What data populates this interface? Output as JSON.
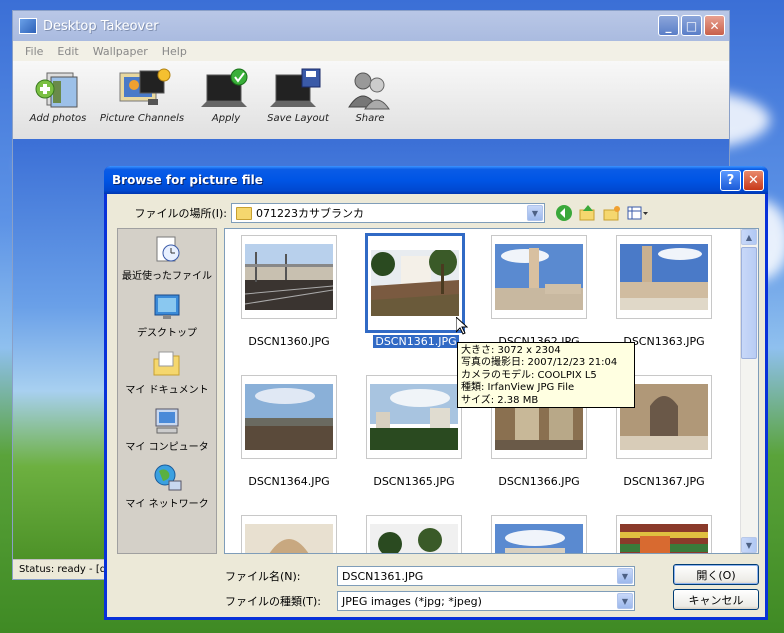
{
  "app": {
    "title": "Desktop Takeover",
    "menu": [
      "File",
      "Edit",
      "Wallpaper",
      "Help"
    ],
    "toolbar": [
      {
        "label": "Add photos",
        "icon": "add-photos-icon"
      },
      {
        "label": "Picture Channels",
        "icon": "picture-channels-icon"
      },
      {
        "label": "Apply",
        "icon": "apply-icon"
      },
      {
        "label": "Save Layout",
        "icon": "save-layout-icon"
      },
      {
        "label": "Share",
        "icon": "share-icon"
      }
    ],
    "status": "Status: ready - [d"
  },
  "dialog": {
    "title": "Browse for picture file",
    "help_btn": "?",
    "close_btn": "✕",
    "lookin_label": "ファイルの場所(I):",
    "lookin_value": "071223カサブランカ",
    "places": [
      {
        "label": "最近使ったファイル",
        "icon": "recent-files-icon"
      },
      {
        "label": "デスクトップ",
        "icon": "desktop-icon"
      },
      {
        "label": "マイ ドキュメント",
        "icon": "my-documents-icon"
      },
      {
        "label": "マイ コンピュータ",
        "icon": "my-computer-icon"
      },
      {
        "label": "マイ ネットワーク",
        "icon": "my-network-icon"
      }
    ],
    "files": [
      "DSCN1360.JPG",
      "DSCN1361.JPG",
      "DSCN1362.JPG",
      "DSCN1363.JPG",
      "DSCN1364.JPG",
      "DSCN1365.JPG",
      "DSCN1366.JPG",
      "DSCN1367.JPG"
    ],
    "selected_file": "DSCN1361.JPG",
    "tooltip": [
      "大きさ: 3072 x 2304",
      "写真の撮影日: 2007/12/23 21:04",
      "カメラのモデル: COOLPIX L5",
      "種類: IrfanView JPG File",
      "サイズ: 2.38 MB"
    ],
    "filename_label": "ファイル名(N):",
    "filename_value": "DSCN1361.JPG",
    "filetype_label": "ファイルの種類(T):",
    "filetype_value": "JPEG images (*jpg; *jpeg)",
    "open_btn": "開く(O)",
    "cancel_btn": "キャンセル"
  }
}
